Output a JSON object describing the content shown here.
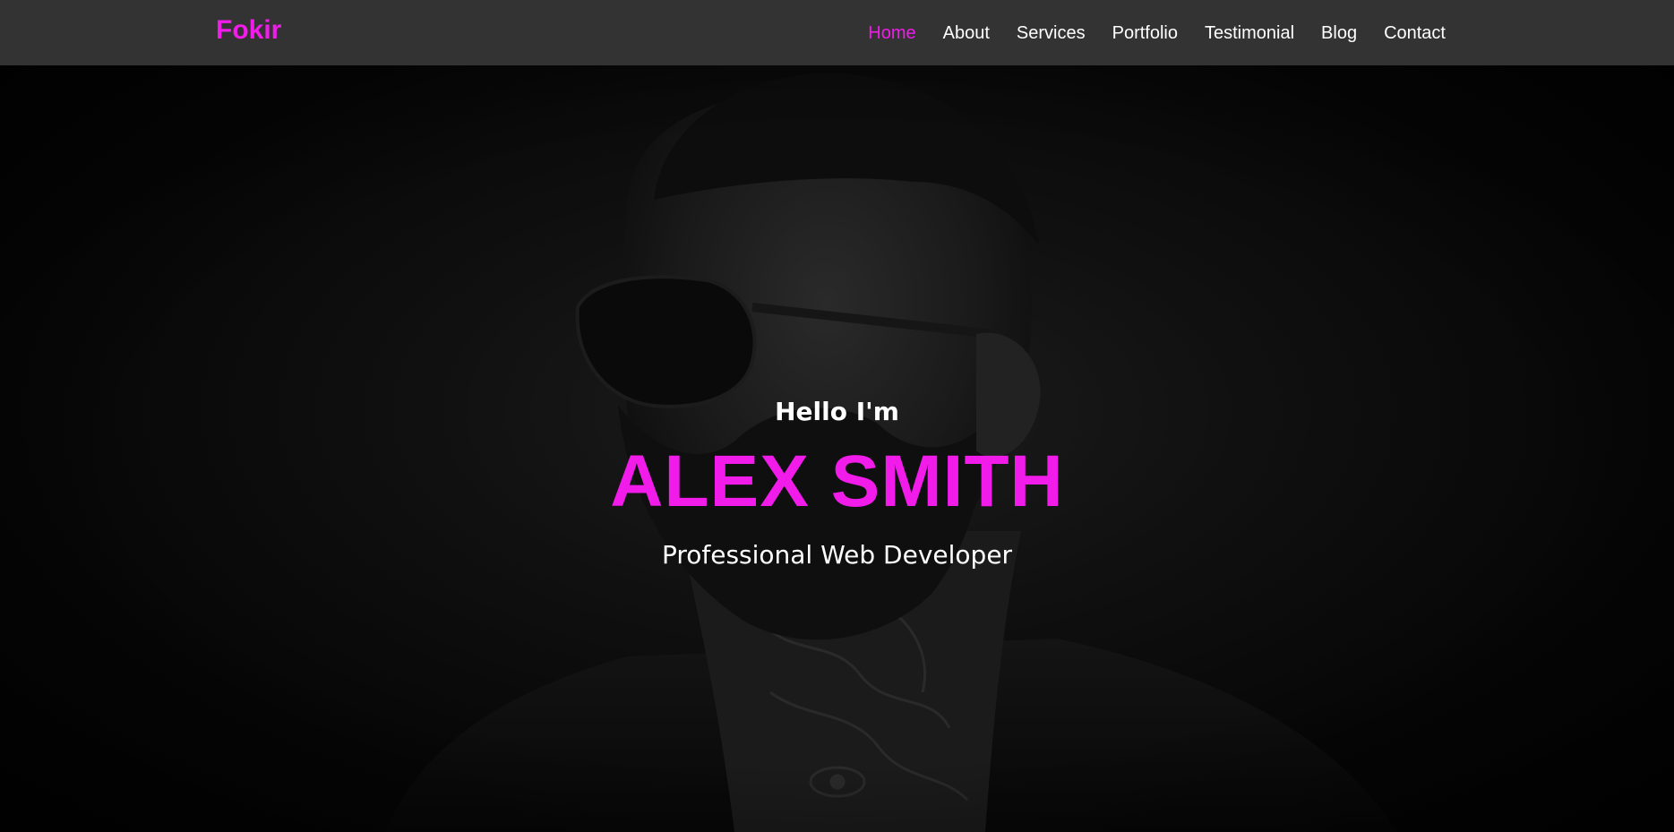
{
  "brand": "Fokir",
  "nav": {
    "items": [
      "Home",
      "About",
      "Services",
      "Portfolio",
      "Testimonial",
      "Blog",
      "Contact"
    ],
    "active": "Home"
  },
  "hero": {
    "greeting": "Hello I'm",
    "name": "ALEX SMITH",
    "role": "Professional Web Developer",
    "background_image": "dark portrait of bearded man with sunglasses and neck tattoos"
  },
  "colors": {
    "accent": "#f11bea",
    "navbar_bg": "#333333",
    "text": "#ffffff",
    "hero_bg": "#050505"
  }
}
